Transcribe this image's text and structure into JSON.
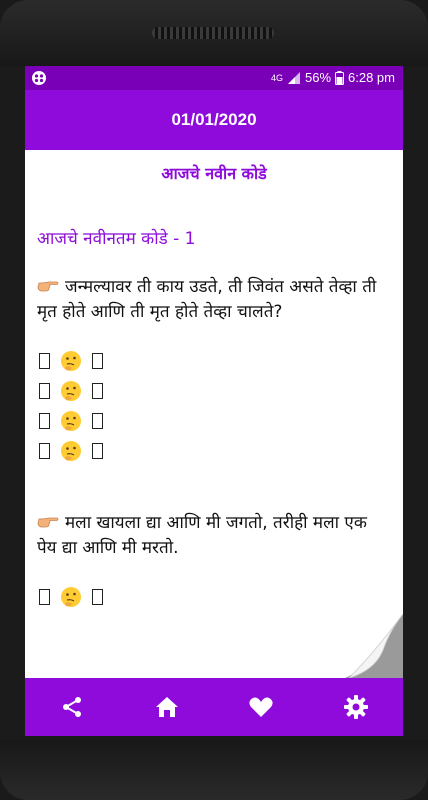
{
  "status": {
    "network": "4G",
    "battery": "56%",
    "time": "6:28 pm"
  },
  "appbar": {
    "title": "01/01/2020"
  },
  "content": {
    "heading": "आजचे नवीन कोडे",
    "subheading": "आजचे नवीनतम कोडे - 1",
    "riddles": [
      {
        "text": "जन्मल्यावर ती काय उडते, ती जिवंत असते तेव्हा ती मृत होते आणि ती मृत होते तेव्हा चालते?"
      },
      {
        "text": "मला खायला द्या आणि मी जगतो, तरीही मला एक पेय द्या आणि मी मरतो."
      }
    ]
  },
  "nav": {
    "items": [
      {
        "icon": "share-icon"
      },
      {
        "icon": "home-icon"
      },
      {
        "icon": "heart-icon"
      },
      {
        "icon": "gear-icon"
      }
    ]
  },
  "colors": {
    "primary": "#8e0bdb",
    "statusbar": "#7a00b8"
  }
}
